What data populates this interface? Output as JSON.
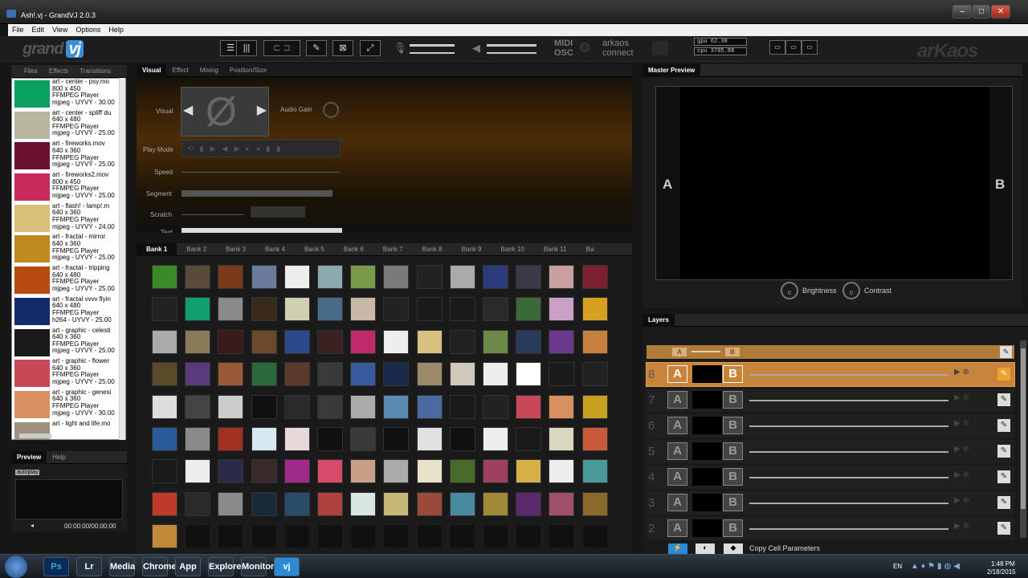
{
  "window": {
    "title": "Ash!.vj - GrandVJ 2.0.3"
  },
  "menu": [
    "File",
    "Edit",
    "View",
    "Options",
    "Help"
  ],
  "toolbar": {
    "logo_left": "grand",
    "logo_vj": "vj",
    "midi": "MIDI",
    "osc": "OSC",
    "arkaos": "arkaos",
    "connect": "connect",
    "gpu": "gpu 62.38",
    "cpu": "cpu 3705.88",
    "logo_right": "arKaos"
  },
  "left_panel": {
    "tabs": [
      "Files",
      "Effects",
      "Transitions"
    ],
    "files": [
      {
        "name": "art - center - psy.mo",
        "size": "800 x 450",
        "player": "FFMPEG Player",
        "codec": "mjpeg - UYVY - 30.00",
        "color": "#0aa060"
      },
      {
        "name": "art - center - spliff du",
        "size": "640 x 480",
        "player": "FFMPEG Player",
        "codec": "mjpeg - UYVY - 25.00",
        "color": "#b8b8a0"
      },
      {
        "name": "art - fireworks.mov",
        "size": "640 x 360",
        "player": "FFMPEG Player",
        "codec": "mjpeg - UYVY - 25.00",
        "color": "#6a1030"
      },
      {
        "name": "art - fireworks2.mov",
        "size": "800 x 450",
        "player": "FFMPEG Player",
        "codec": "mjpeg - UYVY - 25.00",
        "color": "#c82a5a"
      },
      {
        "name": "art - flash! - lamp!.m",
        "size": "640 x 360",
        "player": "FFMPEG Player",
        "codec": "mjpeg - UYVY - 24.00",
        "color": "#d8c07a"
      },
      {
        "name": "art - fractal - mirror",
        "size": "640 x 360",
        "player": "FFMPEG Player",
        "codec": "mjpeg - UYVY - 25.00",
        "color": "#c08a20"
      },
      {
        "name": "art - fractal - tripping",
        "size": "640 x 480",
        "player": "FFMPEG Player",
        "codec": "mjpeg - UYVY - 25.00",
        "color": "#b84a10"
      },
      {
        "name": "art - fractal vvvv flyin",
        "size": "640 x 480",
        "player": "FFMPEG Player",
        "codec": "h264 - UYVY - 25.00",
        "color": "#102a6a"
      },
      {
        "name": "art - graphic - celesti",
        "size": "640 x 360",
        "player": "FFMPEG Player",
        "codec": "mjpeg - UYVY - 25.00",
        "color": "#1a1a1a"
      },
      {
        "name": "art - graphic - flower",
        "size": "640 x 360",
        "player": "FFMPEG Player",
        "codec": "mjpeg - UYVY - 25.00",
        "color": "#c84858"
      },
      {
        "name": "art - graphic - genesi",
        "size": "640 x 360",
        "player": "FFMPEG Player",
        "codec": "mjpeg - UYVY - 30.00",
        "color": "#d89060"
      },
      {
        "name": "art - light and life.mo",
        "size": "",
        "player": "",
        "codec": "",
        "color": "#a09080"
      }
    ],
    "preview_tabs": [
      "Preview",
      "Help"
    ],
    "autoplay": "autoplay",
    "timecode": "00:00:00/00:00:00"
  },
  "visual_panel": {
    "tabs": [
      "Visual",
      "Effect",
      "Mixing",
      "Position/Size"
    ],
    "labels": {
      "visual": "Visual",
      "audio_gain": "Audio Gain",
      "play_mode": "Play Mode",
      "speed": "Speed",
      "segment": "Segment",
      "scratch": "Scratch",
      "text": "Text"
    },
    "empty_symbol": "Ø"
  },
  "banks": {
    "tabs": [
      "Bank 1",
      "Bank 2",
      "Bank 3",
      "Bank 4",
      "Bank 5",
      "Bank 6",
      "Bank 7",
      "Bank 8",
      "Bank 9",
      "Bank 10",
      "Bank 11",
      "Ba"
    ],
    "cells": [
      [
        "#3a8a2a",
        "#5a4a3a",
        "#7a3a1a",
        "#6a7a9a",
        "#eeeeee",
        "#8aaab0",
        "#7a9a4a",
        "#7a7a7a",
        "#222222",
        "#aaaaaa",
        "#2a3a7a",
        "#3a3a4a",
        "#c8a0a0",
        "#7a2030"
      ],
      [
        "#222222",
        "#10a070",
        "#8a8a8a",
        "#3a2a1a",
        "#d0d0b0",
        "#4a6a8a",
        "#c8b8a8",
        "#222222",
        "#1a1a1a",
        "#1a1a1a",
        "#2a2a2a",
        "#3a6a3a",
        "#c8a0c8",
        "#d8a020"
      ],
      [
        "#aaaaaa",
        "#8a7a5a",
        "#3a1a1a",
        "#6a4a2a",
        "#2a4a8a",
        "#3a2020",
        "#c02a6a",
        "#eeeeee",
        "#d8c080",
        "#222222",
        "#6a8a4a",
        "#2a3a5a",
        "#6a3a8a",
        "#c88040"
      ],
      [
        "#5a4a2a",
        "#5a3a7a",
        "#9a5a3a",
        "#2a6a3a",
        "#5a3a2a",
        "#3a3a3a",
        "#3a5aa0",
        "#1a2a4a",
        "#9a8a6a",
        "#d0c8b8",
        "#eeeeee",
        "#ffffff",
        "#1a1a1a",
        "#222222"
      ],
      [
        "#dddddd",
        "#444444",
        "#cccccc",
        "#111111",
        "#2a2a2a",
        "#3a3a3a",
        "#aaaaaa",
        "#5a8ab0",
        "#4a6aa0",
        "#1a1a1a",
        "#222222",
        "#c84858",
        "#d89060",
        "#c8a020"
      ],
      [
        "#2a5a9a",
        "#8a8a8a",
        "#a03020",
        "#d8e8f0",
        "#e8d8d8",
        "#111111",
        "#3a3a3a",
        "#111111",
        "#e0e0e0",
        "#111111",
        "#eeeeee",
        "#1a1a1a",
        "#d8d8c0",
        "#c85a3a"
      ],
      [
        "#1a1a1a",
        "#eeeeee",
        "#2a2a4a",
        "#3a2a2a",
        "#a02a8a",
        "#d84a6a",
        "#c8a088",
        "#aaaaaa",
        "#e8e0c8",
        "#4a6a2a",
        "#a04060",
        "#d8b048",
        "#eeeeee",
        "#4a9a9a"
      ],
      [
        "#c03a2a",
        "#2a2a2a",
        "#8a8a8a",
        "#1a2a3a",
        "#2a4a6a",
        "#b04040",
        "#d8e8e0",
        "#c8b878",
        "#9a4a3a",
        "#4a8aa0",
        "#a08a3a",
        "#5a2a6a",
        "#a0506a",
        "#8a6a2a"
      ],
      [
        "#c08a3a",
        null,
        null,
        null,
        null,
        null,
        null,
        null,
        null,
        null,
        null,
        null,
        null,
        null
      ]
    ]
  },
  "master_preview": {
    "tab": "Master Preview",
    "a": "A",
    "b": "B",
    "brightness": "Brightness",
    "contrast": "Contrast",
    "knob_value": "0"
  },
  "layers": {
    "tab": "Layers",
    "rows": [
      "8",
      "7",
      "6",
      "5",
      "4",
      "3",
      "2"
    ],
    "a": "A",
    "b": "B",
    "copy_cell_params": "Copy Cell Parameters"
  },
  "taskbar": {
    "apps": [
      "Ps",
      "Lr",
      "Media",
      "Chrome",
      "App",
      "Explorer",
      "Monitor",
      "vj"
    ],
    "lang": "EN",
    "time": "1:48 PM",
    "date": "2/18/2015"
  }
}
